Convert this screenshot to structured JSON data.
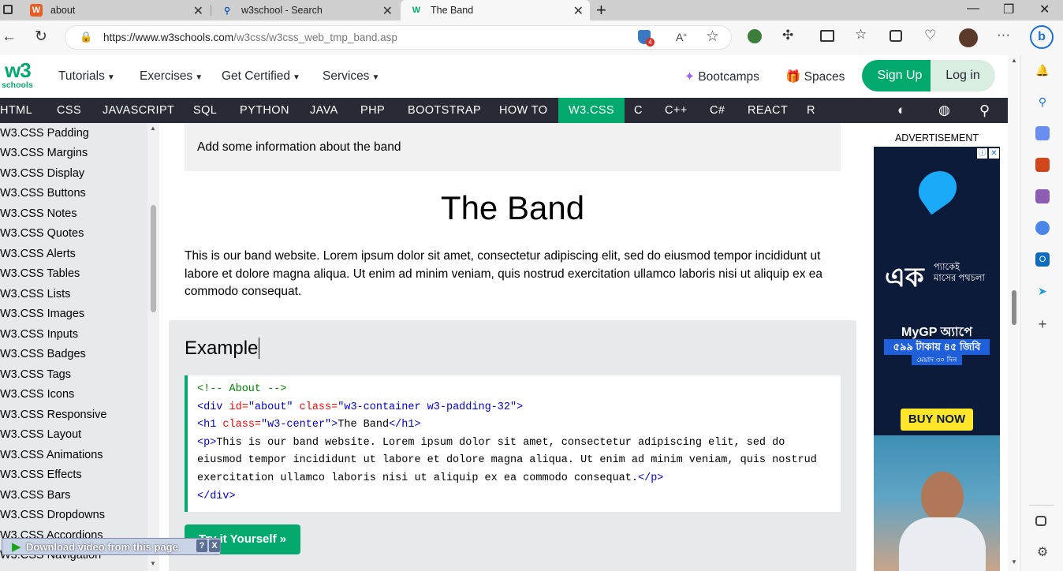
{
  "browser": {
    "tabs": [
      {
        "title": "about",
        "icon": "w3-orange-icon"
      },
      {
        "title": "w3school - Search",
        "icon": "search-icon"
      },
      {
        "title": "The Band",
        "icon": "w3-green-icon"
      }
    ],
    "url_host": "https://www.w3schools.com",
    "url_path": "/w3css/w3css_web_tmp_band.asp",
    "badge_count": "4"
  },
  "w3header": {
    "logo_top": "w3",
    "logo_bottom": "schools",
    "menus": [
      "Tutorials",
      "Exercises",
      "Get Certified",
      "Services"
    ],
    "bootcamps": "Bootcamps",
    "spaces": "Spaces",
    "signup": "Sign Up",
    "login": "Log in"
  },
  "topnav": [
    "HTML",
    "CSS",
    "JAVASCRIPT",
    "SQL",
    "PYTHON",
    "JAVA",
    "PHP",
    "BOOTSTRAP",
    "HOW TO",
    "W3.CSS",
    "C",
    "C++",
    "C#",
    "REACT",
    "R"
  ],
  "topnav_active": "W3.CSS",
  "sidebar": [
    "W3.CSS Padding",
    "W3.CSS Margins",
    "W3.CSS Display",
    "W3.CSS Buttons",
    "W3.CSS Notes",
    "W3.CSS Quotes",
    "W3.CSS Alerts",
    "W3.CSS Tables",
    "W3.CSS Lists",
    "W3.CSS Images",
    "W3.CSS Inputs",
    "W3.CSS Badges",
    "W3.CSS Tags",
    "W3.CSS Icons",
    "W3.CSS Responsive",
    "W3.CSS Layout",
    "W3.CSS Animations",
    "W3.CSS Effects",
    "W3.CSS Bars",
    "W3.CSS Dropdowns",
    "W3.CSS Accordions",
    "W3.CSS Navigation"
  ],
  "main": {
    "info": "Add some information about the band",
    "heading": "The Band",
    "paragraph": "This is our band website. Lorem ipsum dolor sit amet, consectetur adipiscing elit, sed do eiusmod tempor incididunt ut labore et dolore magna aliqua. Ut enim ad minim veniam, quis nostrud exercitation ullamco laboris nisi ut aliquip ex ea commodo consequat.",
    "example_title": "Example",
    "code": {
      "comment": "<!-- About -->",
      "div_open_tag": "<div",
      "div_id_attr": " id=",
      "div_id_val": "\"about\"",
      "div_class_attr": " class=",
      "div_class_val": "\"w3-container w3-padding-32\"",
      "gt": ">",
      "h1_open": "<h1",
      "h1_class_attr": " class=",
      "h1_class_val": "\"w3-center\"",
      "h1_text": "The Band",
      "h1_close": "</h1>",
      "p_open": "<p>",
      "p_line1": "This is our band website. Lorem ipsum dolor sit amet, consectetur adipiscing elit, sed do",
      "p_line2": "eiusmod tempor incididunt ut labore et dolore magna aliqua. Ut enim ad minim veniam, quis nostrud",
      "p_line3": "exercitation ullamco laboris nisi ut aliquip ex ea commodo consequat.",
      "p_close": "</p>",
      "div_close": "</div>"
    },
    "tryit": "Try it Yourself »"
  },
  "ad": {
    "label": "ADVERTISEMENT",
    "bn_line1": "এক",
    "bn_line2": "প্যাকেই",
    "bn_line3": "মাসের পথচলা",
    "mygp": "MyGP অ্যাপে",
    "offer": "৫৯৯ টাকায় ৪৫ জিবি",
    "validity": "মেয়াদ ৩০ দিন",
    "buy": "BUY NOW"
  },
  "download_bar": {
    "label": "Download video from this page",
    "help": "?",
    "close": "X"
  },
  "colors": {
    "w3green": "#04aa6d",
    "topnav": "#282a35",
    "sidebar": "#e7e9eb"
  }
}
